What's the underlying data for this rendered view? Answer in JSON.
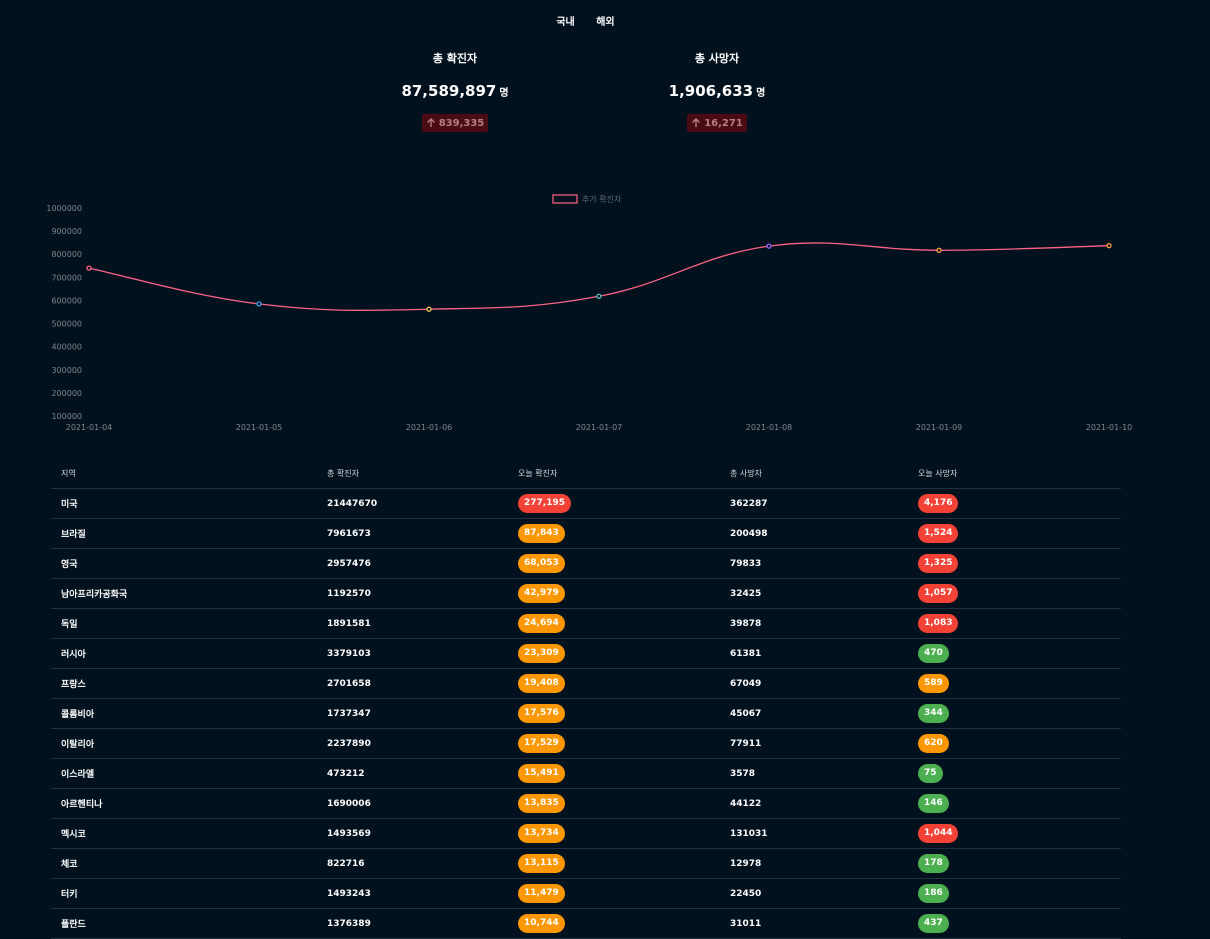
{
  "tabs": [
    {
      "label": "국내"
    },
    {
      "label": "해외"
    }
  ],
  "stats": {
    "confirmed": {
      "label": "총 확진자",
      "value": "87,589,897",
      "unit": "명",
      "delta": "839,335"
    },
    "deaths": {
      "label": "총 사망자",
      "value": "1,906,633",
      "unit": "명",
      "delta": "16,271"
    }
  },
  "colors": {
    "background": "#01111d",
    "line": "#ff6384",
    "pill_red": "#f44336",
    "pill_orange": "#ff9800",
    "pill_green": "#4caf50",
    "delta_bg": "#4a0b14"
  },
  "chart_data": {
    "type": "line",
    "legend_position": "top",
    "x": [
      "2021-01-04",
      "2021-01-05",
      "2021-01-06",
      "2021-01-07",
      "2021-01-08",
      "2021-01-09",
      "2021-01-10"
    ],
    "series": [
      {
        "name": "추가 확진자",
        "values": [
          740000,
          585000,
          562000,
          618000,
          835000,
          817000,
          837000
        ],
        "color": "#ff6384"
      }
    ],
    "point_colors": [
      "#ff6384",
      "#36a2eb",
      "#ffce56",
      "#4bc0c0",
      "#9966ff",
      "#ff9f40",
      "#ff9f40"
    ],
    "ylim": [
      100000,
      1000000
    ],
    "yticks": [
      "1000000",
      "900000",
      "800000",
      "700000",
      "600000",
      "500000",
      "400000",
      "300000",
      "200000",
      "100000"
    ]
  },
  "table": {
    "headers": [
      "지역",
      "총 확진자",
      "오늘 확진자",
      "총 사망자",
      "오늘 사망자"
    ],
    "rows": [
      {
        "region": "미국",
        "total": "21447670",
        "today": "277,195",
        "today_level": "red",
        "deaths": "362287",
        "today_deaths": "4,176",
        "deaths_level": "red"
      },
      {
        "region": "브라질",
        "total": "7961673",
        "today": "87,843",
        "today_level": "orange",
        "deaths": "200498",
        "today_deaths": "1,524",
        "deaths_level": "red"
      },
      {
        "region": "영국",
        "total": "2957476",
        "today": "68,053",
        "today_level": "orange",
        "deaths": "79833",
        "today_deaths": "1,325",
        "deaths_level": "red"
      },
      {
        "region": "남아프리카공화국",
        "total": "1192570",
        "today": "42,979",
        "today_level": "orange",
        "deaths": "32425",
        "today_deaths": "1,057",
        "deaths_level": "red"
      },
      {
        "region": "독일",
        "total": "1891581",
        "today": "24,694",
        "today_level": "orange",
        "deaths": "39878",
        "today_deaths": "1,083",
        "deaths_level": "red"
      },
      {
        "region": "러시아",
        "total": "3379103",
        "today": "23,309",
        "today_level": "orange",
        "deaths": "61381",
        "today_deaths": "470",
        "deaths_level": "green"
      },
      {
        "region": "프랑스",
        "total": "2701658",
        "today": "19,408",
        "today_level": "orange",
        "deaths": "67049",
        "today_deaths": "589",
        "deaths_level": "orange"
      },
      {
        "region": "콜롬비아",
        "total": "1737347",
        "today": "17,576",
        "today_level": "orange",
        "deaths": "45067",
        "today_deaths": "344",
        "deaths_level": "green"
      },
      {
        "region": "이탈리아",
        "total": "2237890",
        "today": "17,529",
        "today_level": "orange",
        "deaths": "77911",
        "today_deaths": "620",
        "deaths_level": "orange"
      },
      {
        "region": "이스라엘",
        "total": "473212",
        "today": "15,491",
        "today_level": "orange",
        "deaths": "3578",
        "today_deaths": "75",
        "deaths_level": "green"
      },
      {
        "region": "아르헨티나",
        "total": "1690006",
        "today": "13,835",
        "today_level": "orange",
        "deaths": "44122",
        "today_deaths": "146",
        "deaths_level": "green"
      },
      {
        "region": "멕시코",
        "total": "1493569",
        "today": "13,734",
        "today_level": "orange",
        "deaths": "131031",
        "today_deaths": "1,044",
        "deaths_level": "red"
      },
      {
        "region": "체코",
        "total": "822716",
        "today": "13,115",
        "today_level": "orange",
        "deaths": "12978",
        "today_deaths": "178",
        "deaths_level": "green"
      },
      {
        "region": "터키",
        "total": "1493243",
        "today": "11,479",
        "today_level": "orange",
        "deaths": "22450",
        "today_deaths": "186",
        "deaths_level": "green"
      },
      {
        "region": "폴란드",
        "total": "1376389",
        "today": "10,744",
        "today_level": "orange",
        "deaths": "31011",
        "today_deaths": "437",
        "deaths_level": "green"
      }
    ]
  }
}
